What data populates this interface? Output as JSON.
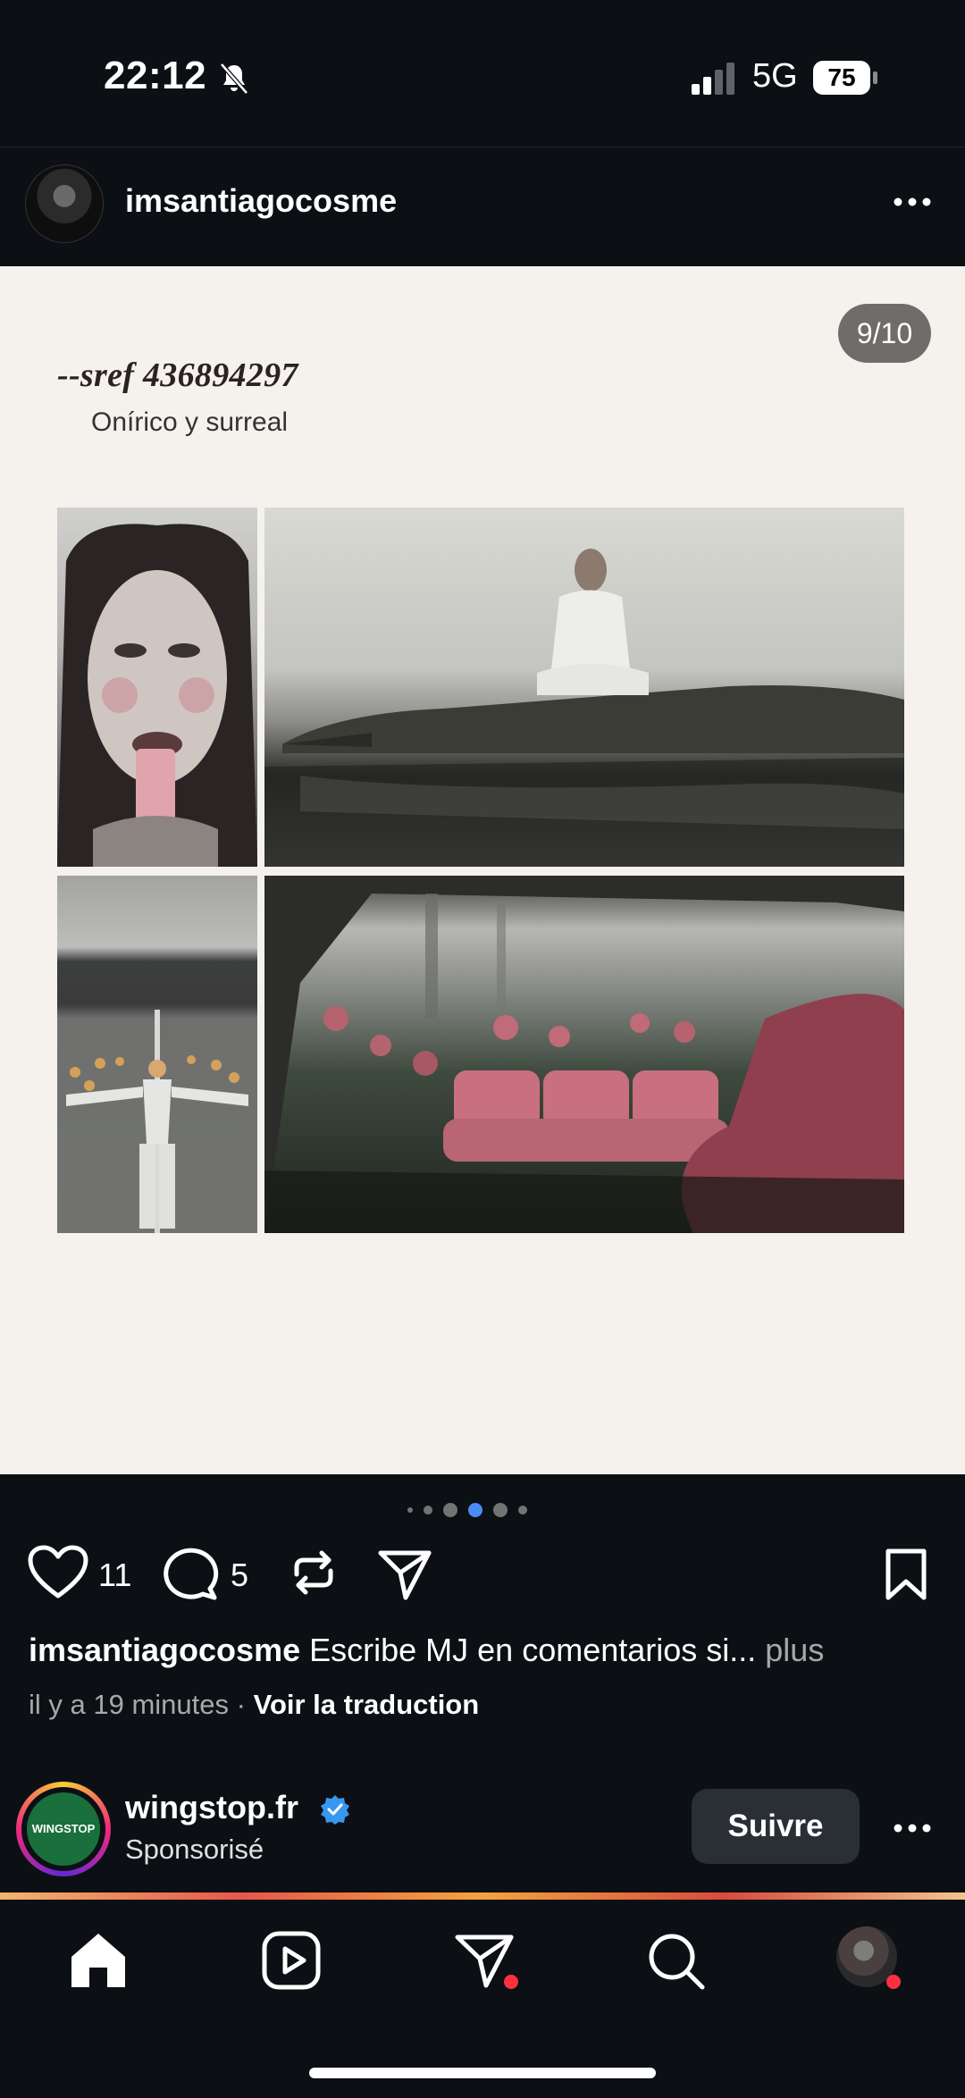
{
  "status_bar": {
    "time": "22:12",
    "network": "5G",
    "battery": "75"
  },
  "post": {
    "author": "imsantiagocosme",
    "slide_counter": "9/10",
    "sref_title": "--sref 436894297",
    "sref_subtitle": "Onírico y surreal",
    "likes": "11",
    "comments": "5",
    "caption_user": "imsantiagocosme",
    "caption_text": " Escribe MJ en comentarios si...",
    "caption_more": " plus",
    "time_ago": "il y a 19 minutes",
    "meta_separator": " · ",
    "translate_label": "Voir la traduction",
    "carousel_active_index": 3,
    "carousel_visible_dots": 6
  },
  "sponsored": {
    "name": "wingstop.fr",
    "label": "Sponsorisé",
    "follow_label": "Suivre",
    "verified": true,
    "avatar_text": "WINGSTOP"
  },
  "nav": {
    "items": [
      "home-icon",
      "reels-icon",
      "direct-icon",
      "search-icon",
      "profile-avatar"
    ]
  },
  "colors": {
    "background": "#0c1014",
    "slide_background": "#f5f2ed",
    "notification_dot": "#ff3040",
    "verified_blue": "#3897f0",
    "active_dot": "#4a8cf7"
  }
}
